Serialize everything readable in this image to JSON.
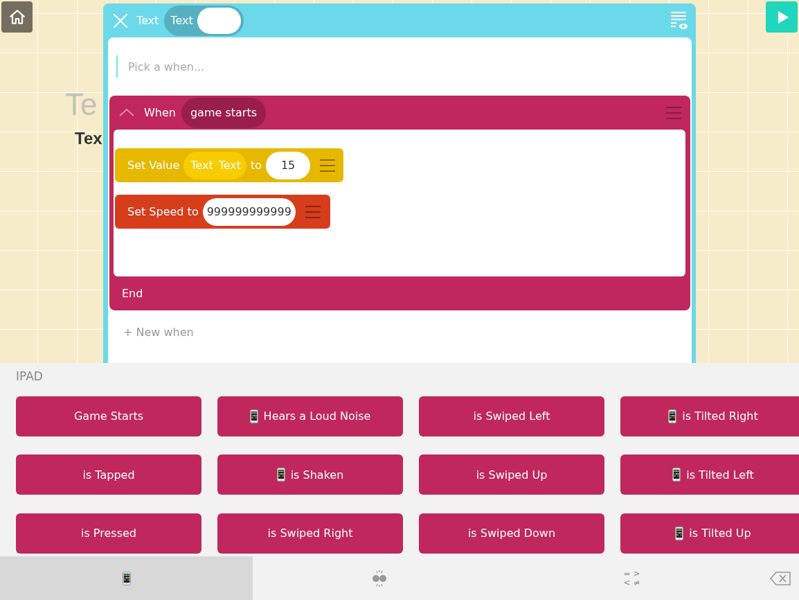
{
  "canvas": {
    "faded_title": "Te",
    "label": "Tex"
  },
  "editor": {
    "header": {
      "label": "Text",
      "object_chip": "Text"
    },
    "when_field": {
      "placeholder": "Pick a when..."
    },
    "when_block": {
      "expanded": true,
      "label": "When",
      "event": "game starts",
      "actions": [
        {
          "kind": "value",
          "label": "Set Value",
          "chip": [
            "Text",
            "Text"
          ],
          "connector": "to",
          "value": "15"
        },
        {
          "kind": "speed",
          "label": "Set Speed to",
          "value": "999999999999"
        }
      ],
      "end_label": "End"
    },
    "new_when": "+ New when"
  },
  "picker": {
    "section": "IPAD",
    "events": [
      {
        "label": "Game Starts",
        "kind": "plain"
      },
      {
        "label": "Hears a Loud Noise",
        "kind": "device"
      },
      {
        "label": "is Swiped Left",
        "kind": "plain"
      },
      {
        "label": "is Tilted Right",
        "kind": "device"
      },
      {
        "label": "is Tapped",
        "kind": "plain"
      },
      {
        "label": "is Shaken",
        "kind": "device"
      },
      {
        "label": "is Swiped Up",
        "kind": "plain"
      },
      {
        "label": "is Tilted Left",
        "kind": "device"
      },
      {
        "label": "is Pressed",
        "kind": "plain"
      },
      {
        "label": "is Swiped Right",
        "kind": "plain"
      },
      {
        "label": "is Swiped Down",
        "kind": "plain"
      },
      {
        "label": "is Tilted Up",
        "kind": "device"
      }
    ],
    "tabs": [
      {
        "kind": "device",
        "selected": true
      },
      {
        "kind": "dots",
        "selected": false
      },
      {
        "kind": "compare",
        "lines": [
          "= >",
          "< ≠"
        ],
        "selected": false
      }
    ]
  }
}
